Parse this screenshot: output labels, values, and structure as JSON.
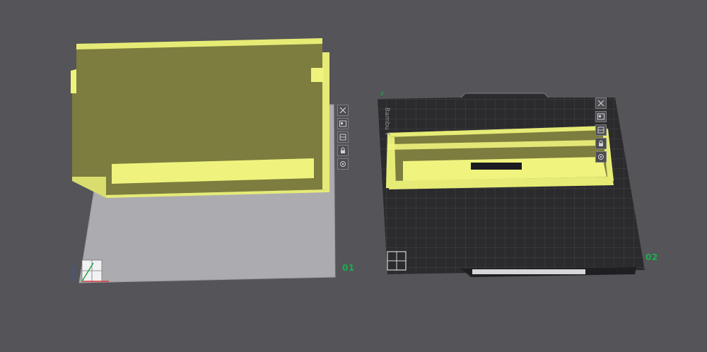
{
  "scene": {
    "background": "#545459",
    "plates": [
      {
        "id": "plate-1",
        "label": "01",
        "type": "texture-plate"
      },
      {
        "id": "plate-2",
        "label": "02",
        "type": "textured-pei-plate",
        "brand_text": "Bambu T"
      }
    ],
    "model_color": "#e8ec78",
    "model_shadow": "#7a7b3d",
    "plate_tools": [
      "close-icon",
      "arrange-icon",
      "orient-icon",
      "lock-icon",
      "settings-icon"
    ],
    "axis_indicator": [
      "x-axis",
      "y-axis",
      "z-axis"
    ],
    "z_marker": "z"
  }
}
